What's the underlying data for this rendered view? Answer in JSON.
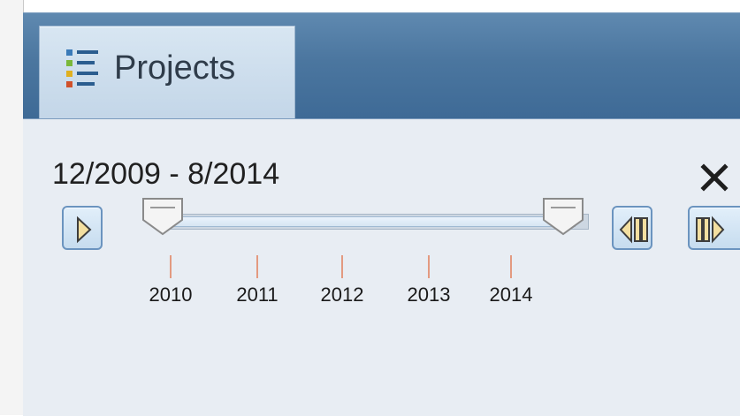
{
  "tab": {
    "label": "Projects",
    "icon": "list-icon"
  },
  "time_slider": {
    "range_label": "12/2009 - 8/2014",
    "start": "12/2009",
    "end": "8/2014",
    "years": [
      "2010",
      "2011",
      "2012",
      "2013",
      "2014"
    ]
  },
  "controls": {
    "play_icon": "play-icon",
    "step_back_icon": "step-back-icon",
    "step_forward_icon": "step-forward-icon",
    "close_icon": "close-icon"
  },
  "colors": {
    "header": "#4b769f",
    "panel": "#e8edf3",
    "tick": "#e39a80",
    "button_border": "#6b94bf"
  }
}
